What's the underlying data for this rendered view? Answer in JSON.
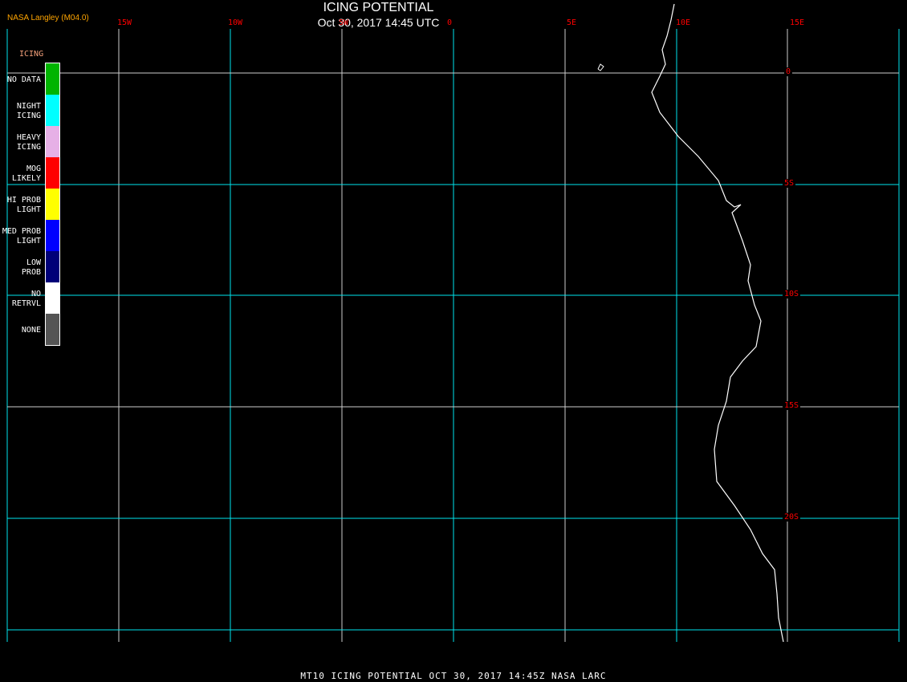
{
  "header": {
    "title": "ICING POTENTIAL",
    "datetime": "Oct 30, 2017 14:45 UTC",
    "credit": "NASA Langley (M04.0)"
  },
  "legend": {
    "title": "ICING",
    "items": [
      {
        "label": "NO DATA",
        "color": "#00b400"
      },
      {
        "label": "NIGHT\nICING",
        "color": "#00ffff"
      },
      {
        "label": "HEAVY\nICING",
        "color": "#e6b0e6"
      },
      {
        "label": "MOG\nLIKELY",
        "color": "#ff0000"
      },
      {
        "label": "HI PROB\nLIGHT",
        "color": "#ffff00"
      },
      {
        "label": "MED PROB\nLIGHT",
        "color": "#0000ff"
      },
      {
        "label": "LOW\nPROB",
        "color": "#000078"
      },
      {
        "label": "NO\nRETRVL",
        "color": "#ffffff"
      },
      {
        "label": "NONE",
        "color": "#555555"
      }
    ]
  },
  "lon_labels": [
    "15W",
    "10W",
    "5W",
    "0",
    "5E",
    "10E",
    "15E"
  ],
  "lat_labels": [
    "0",
    "5S",
    "10S",
    "15S",
    "20S"
  ],
  "footer": "MT10  ICING POTENTIAL   OCT 30, 2017 14:45Z   NASA LARC",
  "colors": {
    "grid_cyan": "#00e5ee",
    "grid_white": "#cccccc",
    "label_red": "#ff0000",
    "coast": "#ffffff"
  }
}
